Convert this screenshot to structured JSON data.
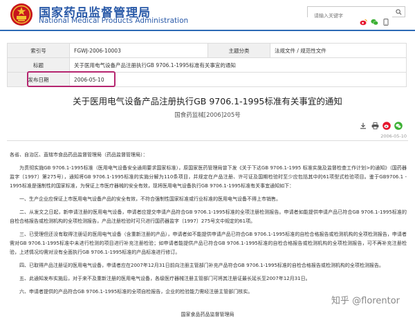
{
  "header": {
    "brand_cn": "国家药品监督管理局",
    "brand_en": "National Medical Products Administration",
    "search_placeholder": "请输入关键字",
    "accent": "#2c6ab5"
  },
  "meta": {
    "rows": [
      {
        "k1": "索引号",
        "v1": "FGWJ-2006-10003",
        "k2": "主题分类",
        "v2": "法规文件 / 规范性文件"
      },
      {
        "k1": "标题",
        "v1": "关于医用电气设备产品注册执行GB 9706.1-1995标准有关事宜的通知"
      },
      {
        "k1": "发布日期",
        "v1": "2006-05-10"
      }
    ]
  },
  "article": {
    "title": "关于医用电气设备产品注册执行GB 9706.1-1995标准有关事宜的通知",
    "doc_no": "国食药监械[2006]205号",
    "date": "2006-05-10",
    "paragraphs": [
      "各省、自治区、直辖市食品药品监督管理局（药品监督管理局）：",
      "为贯彻实施GB 9706.1-1995标准（医用电气设备安全通用要求国家标准），原国家医药管理局曾下发《关于下达GB 9706.1-1995 标准实施及监督检查工作计划>的通知》（国药器监字〔1997〕第275号），通知将GB 9706.1-1995标准的实施分解为110条项目，并规定在产品注册、许可证及国期检验时至少应包括其中的61项型式检验项目。鉴于GB9706.1 - 1995标准是强制性的国家标准，为保证上市医疗器械的安全有效，现将医用电气设备执行GB 9706.1-1995标准有关事宜通知如下：",
      "一、生产企业应保证上市医用电气设备产品的安全有效，不符合强制性国家标准或行业标准的医用电气设备不得上市销售。",
      "二、从发文之日起，新申请注册的医用电气设备，申请者应提交申请产品符合GB 9706.1-1995标准的全项注册检测报告。申请者如能提供申请产品已符合GB 9706.1-1995标准的自检合格报告或检测机构的全项检测报告，产品注册检验时可只进行国药器监字〔1997〕275号文中规定的61项。",
      "三、已受理但还没有取得注册证的医用电气设备（含重新注册的产品），申请者如不能提供申请产品已符合GB 9706.1-1995标准的自检合格报告或检测机构的全项检测报告，申请者需对GB 9706.1-1995标准中未进行检测的项目进行补充注册检验；如申请者能提供产品已符合GB 9706.1-1995标准的自检合格报告或检测机构的全项检测报告，可不再补充注册检验，上述情况均需对没有全面执行GB 9706.1-1995标准的产品标准进行修订。",
      "四、已取得产品注册证的医用电气设备，申请者应在2007年12月31日前向注册主管部门补充产品符合GB 9706.1-1995标准的自检合格报告或检测机构的全项检测报告。",
      "五、此通知发布实施后，对于来不及重新注册的医用电气设备，各级医疗器械注册主管部门可将其注册证最长延长至2007年12月31日。",
      "六、申请者提供的产品符合GB 9706.1-1995标准的全项自检报告，企业的检验能力需经注册主管部门核实。"
    ],
    "signature": "国家食品药品监督管理局"
  },
  "watermark": "知乎 @florentor",
  "icons": [
    "emblem-icon",
    "search-icon",
    "weibo-icon",
    "wechat-icon",
    "mobile-icon",
    "download-icon",
    "print-icon",
    "weibo-share-icon",
    "wechat-share-icon"
  ]
}
